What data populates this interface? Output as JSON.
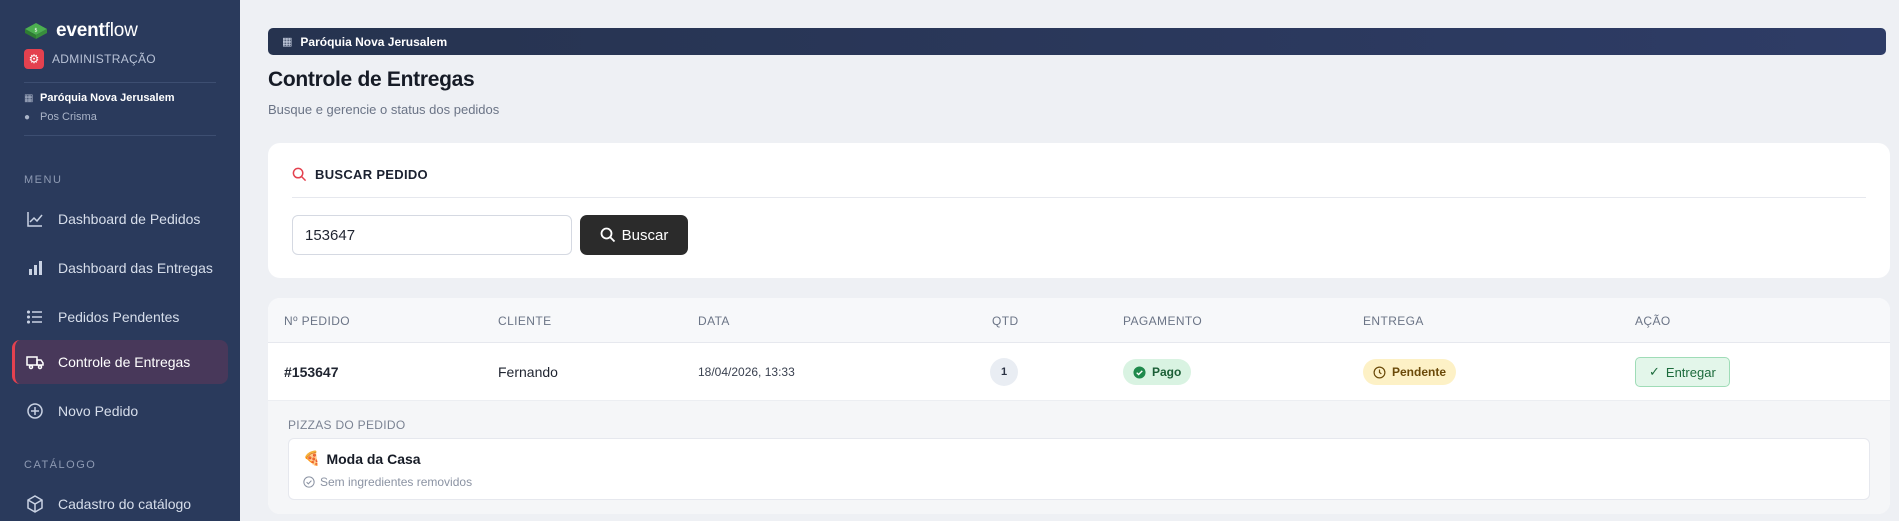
{
  "brand": {
    "name_bold": "event",
    "name_light": "flow",
    "admin_label": "ADMINISTRAÇÃO"
  },
  "org": {
    "name": "Paróquia Nova Jerusalem",
    "user": "Pos Crisma"
  },
  "sidebar": {
    "menu_label": "MENU",
    "items": [
      {
        "label": "Dashboard de Pedidos",
        "icon": "line-chart-icon"
      },
      {
        "label": "Dashboard das Entregas",
        "icon": "bar-chart-icon"
      },
      {
        "label": "Pedidos Pendentes",
        "icon": "list-icon"
      },
      {
        "label": "Controle de Entregas",
        "icon": "truck-icon",
        "active": true
      },
      {
        "label": "Novo Pedido",
        "icon": "plus-circle-icon"
      }
    ],
    "catalog_label": "CATÁLOGO",
    "catalog_items": [
      {
        "label": "Cadastro do catálogo",
        "icon": "box-icon"
      }
    ]
  },
  "banner": {
    "org_name": "Paróquia Nova Jerusalem"
  },
  "page": {
    "title": "Controle de Entregas",
    "subtitle": "Busque e gerencie o status dos pedidos"
  },
  "search": {
    "title": "BUSCAR PEDIDO",
    "value": "153647",
    "button_label": "Buscar"
  },
  "table": {
    "headers": [
      "Nº PEDIDO",
      "CLIENTE",
      "DATA",
      "QTD",
      "PAGAMENTO",
      "ENTREGA",
      "AÇÃO"
    ],
    "rows": [
      {
        "order": "#153647",
        "client": "Fernando",
        "date": "18/04/2026, 13:33",
        "qty": "1",
        "payment": "Pago",
        "delivery": "Pendente",
        "action": "Entregar"
      }
    ],
    "details": {
      "label": "PIZZAS DO PEDIDO",
      "pizzas": [
        {
          "name": "Moda da Casa",
          "note": "Sem ingredientes removidos"
        }
      ]
    }
  },
  "colors": {
    "sidebar_bg": "#2a3a5c",
    "accent": "#e4414f",
    "success": "#1b5e36",
    "warning": "#6b4a09"
  }
}
